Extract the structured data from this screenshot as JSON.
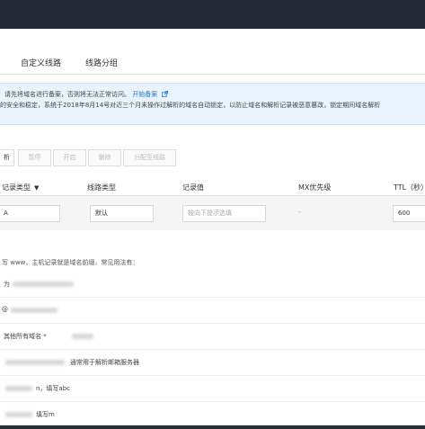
{
  "tabs": [
    "自定义线路",
    "线路分组"
  ],
  "notice": {
    "line1_text": "请先将域名进行备案，否则将无法正常访问。",
    "line1_link": "开始备案",
    "line2_text": "的安全和稳定，系统于2018年8月14号对近三个月未操作过解析的域名自动锁定，以防止域名和解析记录被恶意篡改，锁定期间域名解析"
  },
  "toolbar": {
    "buttons": [
      "析",
      "暂停",
      "开启",
      "删除",
      "分配至线路"
    ]
  },
  "table": {
    "headers": {
      "record_type": "记录类型",
      "line_type": "线路类型",
      "record_value": "记录值",
      "mx_priority": "MX优先级",
      "ttl": "TTL（秒）"
    },
    "edit_row": {
      "record_type": "A",
      "line_type": "默认",
      "record_value_placeholder": "按向下提示选填",
      "mx_priority": "-",
      "ttl": "600"
    }
  },
  "usage": {
    "title": "写 www，主机记录就是域名前缀，常见用法有：",
    "rows": [
      {
        "text": "为"
      },
      {
        "text": "@"
      },
      {
        "text": "其他所有域名 *"
      },
      {
        "text": "通常用于解析邮箱服务器"
      },
      {
        "text": "n，填写abc"
      },
      {
        "text": "填写m"
      }
    ]
  },
  "colors": {
    "topbar": "#232a35",
    "notice_bg": "#eaf3fb",
    "link": "#1f7ad6",
    "edit_row_bg": "#f5f5f5"
  }
}
